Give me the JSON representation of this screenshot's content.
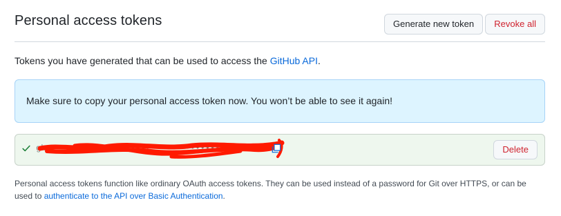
{
  "header": {
    "title": "Personal access tokens",
    "generate_label": "Generate new token",
    "revoke_label": "Revoke all"
  },
  "intro": {
    "text_before": "Tokens you have generated that can be used to access the ",
    "link_text": "GitHub API",
    "text_after": "."
  },
  "flash": {
    "message": "Make sure to copy your personal access token now. You won’t be able to see it again!"
  },
  "token": {
    "value": "ghp_••••••••••••••••••••••••••••••••••••••••••••",
    "delete_label": "Delete",
    "status_icon": "check-icon",
    "copy_icon": "copy-icon",
    "redaction_color": "#ff1a00"
  },
  "footnote": {
    "text_before": "Personal access tokens function like ordinary OAuth access tokens. They can be used instead of a password for Git over HTTPS, or can be used to ",
    "link_text": "authenticate to the API over Basic Authentication",
    "text_after": "."
  },
  "colors": {
    "link": "#0969da",
    "danger": "#cf222e",
    "flash_bg": "#ddf4ff",
    "success_bg": "#eef7ee",
    "success": "#1a7f37"
  }
}
